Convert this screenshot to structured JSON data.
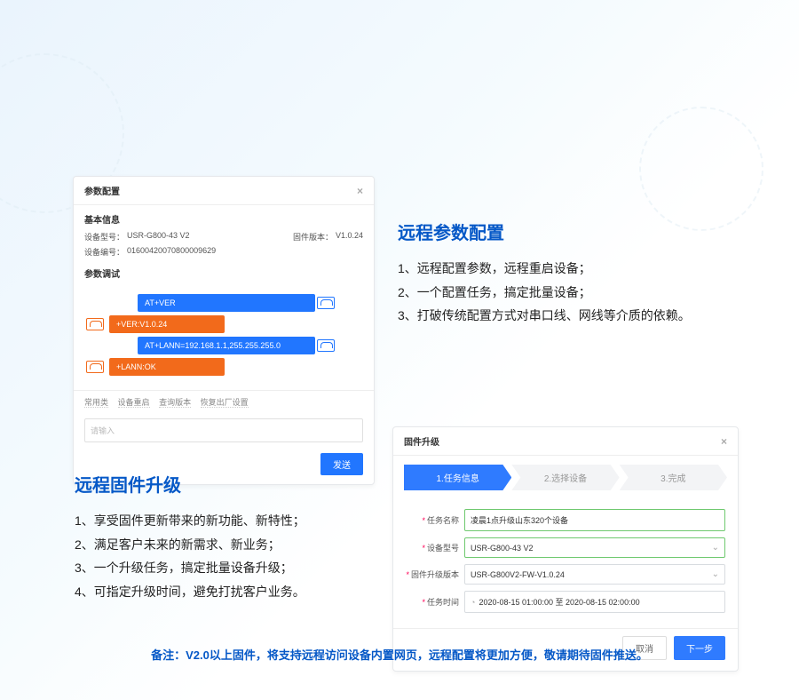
{
  "param_panel": {
    "title": "参数配置",
    "basic_info_title": "基本信息",
    "model_label": "设备型号：",
    "model_value": "USR-G800-43 V2",
    "fw_label": "固件版本：",
    "fw_value": "V1.0.24",
    "id_label": "设备编号：",
    "id_value": "01600420070800009629",
    "debug_title": "参数调试",
    "cmd1": "AT+VER",
    "cmd2": "+VER:V1.0.24",
    "cmd3": "AT+LANN=192.168.1.1,255.255.255.0",
    "cmd4": "+LANN:OK",
    "quick1": "常用类",
    "quick2": "设备重启",
    "quick3": "查询版本",
    "quick4": "恢复出厂设置",
    "placeholder": "请输入",
    "send": "发送"
  },
  "text1": {
    "title": "远程参数配置",
    "l1": "1、远程配置参数，远程重启设备；",
    "l2": "2、一个配置任务，搞定批量设备；",
    "l3": "3、打破传统配置方式对串口线、网线等介质的依赖。"
  },
  "text2": {
    "title": "远程固件升级",
    "l1": "1、享受固件更新带来的新功能、新特性；",
    "l2": "2、满足客户未来的新需求、新业务；",
    "l3": "3、一个升级任务，搞定批量设备升级；",
    "l4": "4、可指定升级时间，避免打扰客户业务。"
  },
  "fw_panel": {
    "title": "固件升级",
    "step1": "1.任务信息",
    "step2": "2.选择设备",
    "step3": "3.完成",
    "task_label": "任务名称",
    "task_value": "凌晨1点升级山东320个设备",
    "model_label": "设备型号",
    "model_value": "USR-G800-43 V2",
    "fwver_label": "固件升级版本",
    "fwver_value": "USR-G800V2-FW-V1.0.24",
    "time_label": "任务时间",
    "time_value": "2020-08-15 01:00:00  至  2020-08-15 02:00:00",
    "cancel": "取消",
    "next": "下一步"
  },
  "footer": "备注：V2.0以上固件，将支持远程访问设备内置网页，远程配置将更加方便，敬请期待固件推送。"
}
